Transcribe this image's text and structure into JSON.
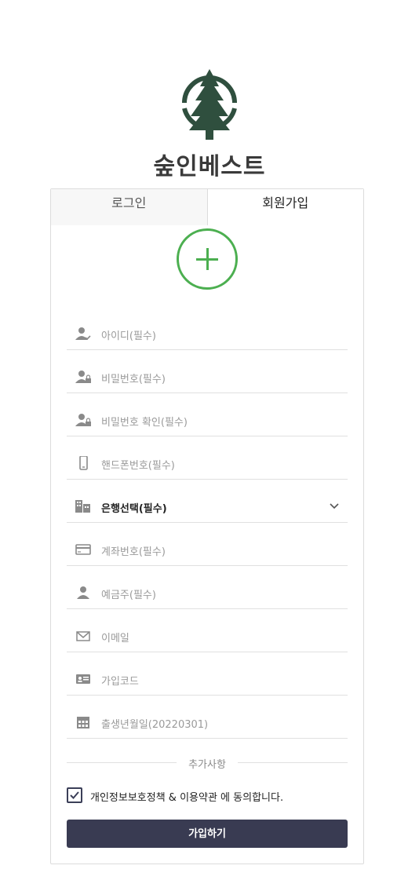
{
  "brand": {
    "name": "숲인베스트",
    "logo_icon": "pine-tree-icon",
    "logo_color": "#2f4f3e"
  },
  "tabs": [
    {
      "label": "로그인",
      "active": false
    },
    {
      "label": "회원가입",
      "active": true
    }
  ],
  "avatar_upload": {
    "icon": "plus-icon",
    "color": "#4caf50"
  },
  "fields": [
    {
      "icon": "user-check-icon",
      "placeholder": "아이디(필수)"
    },
    {
      "icon": "user-lock-icon",
      "placeholder": "비밀번호(필수)"
    },
    {
      "icon": "user-lock-icon",
      "placeholder": "비밀번호 확인(필수)"
    },
    {
      "icon": "phone-icon",
      "placeholder": "핸드폰번호(필수)"
    },
    {
      "icon": "bank-icon",
      "value": "은행선택(필수)",
      "type": "select"
    },
    {
      "icon": "card-icon",
      "placeholder": "계좌번호(필수)"
    },
    {
      "icon": "user-icon",
      "placeholder": "예금주(필수)"
    },
    {
      "icon": "mail-icon",
      "placeholder": "이메일"
    },
    {
      "icon": "id-card-icon",
      "placeholder": "가입코드"
    },
    {
      "icon": "calendar-icon",
      "placeholder": "출생년월일(20220301)"
    }
  ],
  "extras": {
    "label": "추가사항"
  },
  "agreement": {
    "label": "개인정보보호정책 & 이용약관 에 동의합니다.",
    "checked": true
  },
  "submit": {
    "label": "가입하기",
    "color": "#393b52"
  }
}
